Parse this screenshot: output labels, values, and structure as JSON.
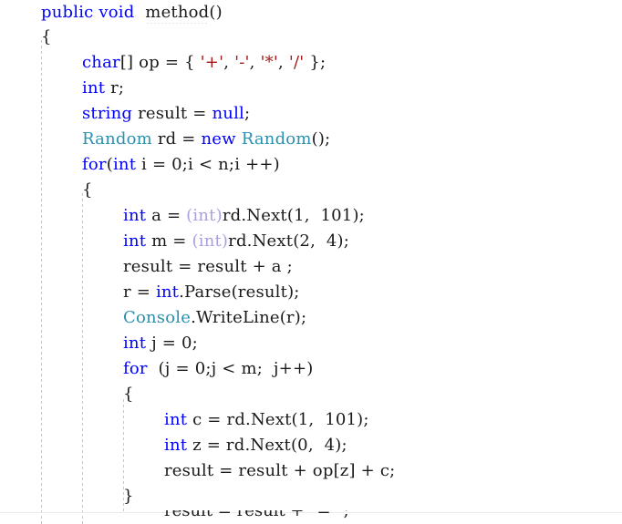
{
  "editor": {
    "name": "code-editor",
    "language": "csharp",
    "background_color": "#ffffff",
    "font_size_px": 18,
    "line_height_px": 28,
    "colors": {
      "keyword": "#0000ff",
      "type": "#2b91af",
      "cast_dimmed": "#a9a0e0",
      "char_literal": "#a31515",
      "plain_text": "#1a1a1a",
      "indent_guide": "#c6c6c6",
      "squiggle": "#9a9a9a",
      "separator_rule": "#e8eaf0"
    }
  },
  "code": {
    "lines": [
      {
        "id": "line-1",
        "indent": 1,
        "tokens": [
          {
            "t": "public",
            "k": "kw"
          },
          {
            "t": " ",
            "k": "plain"
          },
          {
            "t": "void",
            "k": "kw"
          },
          {
            "t": "  ",
            "k": "plain"
          },
          {
            "t": "method",
            "k": "plain",
            "squiggle": true
          },
          {
            "t": "()",
            "k": "punct"
          }
        ]
      },
      {
        "id": "line-2",
        "indent": 1,
        "tokens": [
          {
            "t": "{",
            "k": "brace"
          }
        ]
      },
      {
        "id": "line-3",
        "indent": 2,
        "tokens": [
          {
            "t": "char",
            "k": "kw"
          },
          {
            "t": "[] op = { ",
            "k": "plain"
          },
          {
            "t": "'+'",
            "k": "char"
          },
          {
            "t": ", ",
            "k": "plain"
          },
          {
            "t": "'-'",
            "k": "char"
          },
          {
            "t": ", ",
            "k": "plain"
          },
          {
            "t": "'*'",
            "k": "char"
          },
          {
            "t": ", ",
            "k": "plain"
          },
          {
            "t": "'/'",
            "k": "char"
          },
          {
            "t": " };",
            "k": "plain"
          }
        ]
      },
      {
        "id": "line-4",
        "indent": 2,
        "tokens": [
          {
            "t": "int",
            "k": "kw"
          },
          {
            "t": " r;",
            "k": "plain"
          }
        ]
      },
      {
        "id": "line-5",
        "indent": 2,
        "tokens": [
          {
            "t": "string",
            "k": "kw"
          },
          {
            "t": " result = ",
            "k": "plain"
          },
          {
            "t": "null",
            "k": "kw"
          },
          {
            "t": ";",
            "k": "plain"
          }
        ]
      },
      {
        "id": "line-6",
        "indent": 2,
        "tokens": [
          {
            "t": "Random",
            "k": "type"
          },
          {
            "t": " rd = ",
            "k": "plain"
          },
          {
            "t": "new",
            "k": "kw"
          },
          {
            "t": " ",
            "k": "plain"
          },
          {
            "t": "Random",
            "k": "type"
          },
          {
            "t": "();",
            "k": "plain"
          }
        ]
      },
      {
        "id": "line-7",
        "indent": 2,
        "tokens": [
          {
            "t": "for",
            "k": "kw"
          },
          {
            "t": "(",
            "k": "plain"
          },
          {
            "t": "int",
            "k": "kw"
          },
          {
            "t": " i = 0;i < n;i ++)",
            "k": "plain"
          }
        ]
      },
      {
        "id": "line-8",
        "indent": 2,
        "tokens": [
          {
            "t": "{",
            "k": "brace"
          }
        ]
      },
      {
        "id": "line-9",
        "indent": 3,
        "tokens": [
          {
            "t": "int",
            "k": "kw"
          },
          {
            "t": " a = ",
            "k": "plain"
          },
          {
            "t": "(int)",
            "k": "cast"
          },
          {
            "t": "rd.Next(1,  101);",
            "k": "plain"
          }
        ]
      },
      {
        "id": "line-10",
        "indent": 3,
        "tokens": [
          {
            "t": "int",
            "k": "kw"
          },
          {
            "t": " m = ",
            "k": "plain"
          },
          {
            "t": "(int)",
            "k": "cast"
          },
          {
            "t": "rd.Next(2,  4);",
            "k": "plain"
          }
        ]
      },
      {
        "id": "line-11",
        "indent": 3,
        "tokens": [
          {
            "t": "result = result + a ;",
            "k": "plain"
          }
        ]
      },
      {
        "id": "line-12",
        "indent": 3,
        "tokens": [
          {
            "t": "r = ",
            "k": "plain"
          },
          {
            "t": "int",
            "k": "kw"
          },
          {
            "t": ".Parse(result);",
            "k": "plain"
          }
        ]
      },
      {
        "id": "line-13",
        "indent": 3,
        "tokens": [
          {
            "t": "Console",
            "k": "type"
          },
          {
            "t": ".WriteLine(r);",
            "k": "plain"
          }
        ]
      },
      {
        "id": "line-14",
        "indent": 3,
        "tokens": [
          {
            "t": "int",
            "k": "kw"
          },
          {
            "t": " j = 0;",
            "k": "plain"
          }
        ]
      },
      {
        "id": "line-15",
        "indent": 3,
        "tokens": [
          {
            "t": "for",
            "k": "kw"
          },
          {
            "t": "  (j = 0;j < m;  j++)",
            "k": "plain"
          }
        ]
      },
      {
        "id": "line-16",
        "indent": 3,
        "tokens": [
          {
            "t": "{",
            "k": "brace"
          }
        ]
      },
      {
        "id": "line-17",
        "indent": 4,
        "tokens": [
          {
            "t": "int",
            "k": "kw"
          },
          {
            "t": " c = rd.Next(1,  101);",
            "k": "plain"
          }
        ]
      },
      {
        "id": "line-18",
        "indent": 4,
        "tokens": [
          {
            "t": "int",
            "k": "kw"
          },
          {
            "t": " z = rd.Next(0,  4);",
            "k": "plain"
          }
        ]
      },
      {
        "id": "line-19",
        "indent": 4,
        "tokens": [
          {
            "t": "result = result + op[z] + c;",
            "k": "plain"
          }
        ]
      },
      {
        "id": "line-20",
        "indent": 3,
        "tokens": [
          {
            "t": "}",
            "k": "brace"
          }
        ]
      }
    ],
    "clipped_bottom_line": {
      "id": "line-21-clipped",
      "indent": 4,
      "text": "result = result + \"=\" ;"
    }
  }
}
